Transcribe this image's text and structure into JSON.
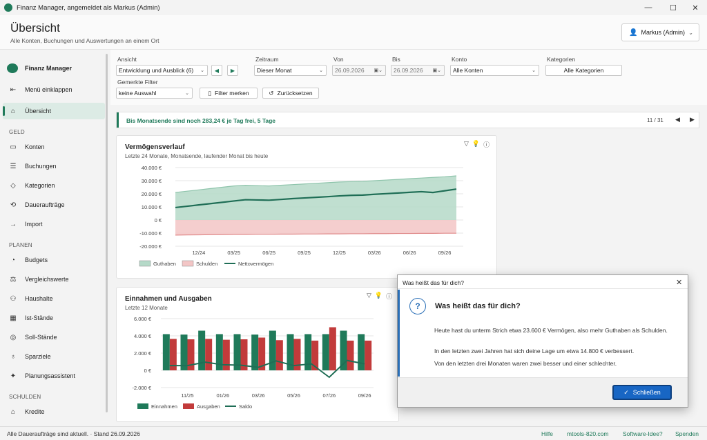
{
  "window": {
    "title": "Finanz Manager, angemeldet als Markus (Admin)",
    "minimize": "—",
    "maximize": "☐",
    "close": "✕"
  },
  "header": {
    "title": "Übersicht",
    "subtitle": "Alle Konten, Buchungen und Auswertungen an einem Ort",
    "user": "Markus (Admin)"
  },
  "sidebar": {
    "brand": "Finanz Manager",
    "collapse": "Menü einklappen",
    "overview": "Übersicht",
    "sections": {
      "geld": "GELD",
      "planen": "PLANEN",
      "schulden": "SCHULDEN"
    },
    "geld_items": [
      "Konten",
      "Buchungen",
      "Kategorien",
      "Daueraufträge",
      "Import"
    ],
    "planen_items": [
      "Budgets",
      "Vergleichswerte",
      "Haushalte",
      "Ist-Stände",
      "Soll-Stände",
      "Sparziele",
      "Planungsassistent"
    ],
    "schulden_items": [
      "Kredite"
    ]
  },
  "filters": {
    "ansicht_label": "Ansicht",
    "ansicht_value": "Entwicklung und Ausblick (6)",
    "zeitraum_label": "Zeitraum",
    "zeitraum_value": "Dieser Monat",
    "von_label": "Von",
    "von_value": "26.09.2026",
    "bis_label": "Bis",
    "bis_value": "26.09.2026",
    "konto_label": "Konto",
    "konto_value": "Alle Konten",
    "kategorien_label": "Kategorien",
    "kategorien_value": "Alle Kategorien",
    "gemerkte_label": "Gemerkte Filter",
    "gemerkte_value": "keine Auswahl",
    "merken": "Filter merken",
    "reset": "Zurücksetzen"
  },
  "banner": {
    "text": "Bis Monatsende sind noch 283,24 € je Tag frei, 5 Tage",
    "page": "11 / 31"
  },
  "card1": {
    "title": "Vermögensverlauf",
    "subtitle": "Letzte 24 Monate, Monatsende, laufender Monat bis heute"
  },
  "card2": {
    "title": "Einnahmen und Ausgaben",
    "subtitle": "Letzte 12 Monate"
  },
  "chart_data": [
    {
      "type": "area",
      "y_ticks": [
        "40.000 €",
        "30.000 €",
        "20.000 €",
        "10.000 €",
        "0 €",
        "-10.000 €",
        "-20.000 €"
      ],
      "ylim": [
        -20000,
        40000
      ],
      "x_ticks": [
        "12/24",
        "03/25",
        "06/25",
        "09/25",
        "12/25",
        "03/26",
        "06/26",
        "09/26"
      ],
      "legend": [
        "Guthaben",
        "Schulden",
        "Nettovermögen"
      ],
      "colors": {
        "guthaben": "#b5d9c8",
        "schulden": "#f3c6c6",
        "netto": "#1f6e56"
      },
      "series": [
        {
          "name": "Guthaben",
          "values": [
            21000,
            22000,
            23000,
            24000,
            25000,
            26000,
            26500,
            26200,
            26000,
            26500,
            27000,
            27500,
            28000,
            28500,
            29000,
            29300,
            29500,
            30000,
            30500,
            31000,
            31500,
            32000,
            32500,
            33000,
            33700
          ]
        },
        {
          "name": "Schulden",
          "values": [
            -11500,
            -11400,
            -11300,
            -11200,
            -11100,
            -11000,
            -11000,
            -10900,
            -10900,
            -10800,
            -10800,
            -10700,
            -10700,
            -10600,
            -10600,
            -10500,
            -10500,
            -10400,
            -10400,
            -10300,
            -10300,
            -10200,
            -10200,
            -10100,
            -10100
          ]
        },
        {
          "name": "Nettovermögen",
          "values": [
            9500,
            10500,
            11500,
            12500,
            13500,
            14500,
            15500,
            15300,
            15100,
            15700,
            16300,
            16800,
            17300,
            17800,
            18400,
            18800,
            19000,
            19600,
            20100,
            20600,
            21100,
            21600,
            21000,
            22300,
            23600
          ]
        }
      ]
    },
    {
      "type": "bar",
      "y_ticks": [
        "6.000 €",
        "4.000 €",
        "2.000 €",
        "0 €",
        "-2.000 €"
      ],
      "ylim": [
        -2000,
        6000
      ],
      "x_ticks": [
        "11/25",
        "01/26",
        "03/26",
        "05/26",
        "07/26",
        "09/26"
      ],
      "legend": [
        "Einnahmen",
        "Ausgaben",
        "Saldo"
      ],
      "colors": {
        "einnahmen": "#1f7a5a",
        "ausgaben": "#c23b3b",
        "saldo": "#1f6e56"
      },
      "categories": [
        "10/25",
        "11/25",
        "12/25",
        "01/26",
        "02/26",
        "03/26",
        "04/26",
        "05/26",
        "06/26",
        "07/26",
        "08/26",
        "09/26"
      ],
      "series": [
        {
          "name": "Einnahmen",
          "values": [
            4200,
            4150,
            4600,
            4200,
            4200,
            4150,
            4600,
            4200,
            4200,
            4200,
            4600,
            4200
          ]
        },
        {
          "name": "Ausgaben",
          "values": [
            3650,
            3600,
            3650,
            3550,
            3600,
            3800,
            3500,
            3650,
            3450,
            5000,
            3450,
            3450
          ]
        },
        {
          "name": "Saldo",
          "values": [
            550,
            550,
            950,
            650,
            600,
            350,
            1100,
            550,
            750,
            -800,
            1150,
            750
          ]
        }
      ]
    }
  ],
  "dialog": {
    "title": "Was heißt das für dich?",
    "heading": "Was heißt das für dich?",
    "p1": "Heute hast du unterm Strich etwa 23.600 € Vermögen, also mehr Guthaben als Schulden.",
    "p2": "In den letzten zwei Jahren hat sich deine Lage um etwa 14.800 € verbessert.",
    "p3": "Von den letzten drei Monaten waren zwei besser und einer schlechter.",
    "button": "Schließen"
  },
  "status": {
    "text": "Alle Daueraufträge sind aktuell.  ·  Stand 26.09.2026",
    "links": [
      "Hilfe",
      "mtools-820.com",
      "Software-Idee?",
      "Spenden"
    ]
  }
}
